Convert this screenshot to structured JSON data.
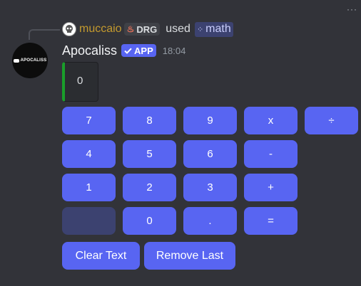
{
  "reply": {
    "username": "muccaio",
    "tag": "DRG",
    "tag_icon": "flame-icon",
    "used": "used",
    "command": "math",
    "command_icon": "app-command-icon"
  },
  "message": {
    "author": "Apocaliss",
    "avatar_text": "APOCALISS",
    "app_badge": "APP",
    "timestamp": "18:04"
  },
  "display": {
    "value": "0",
    "accent_color": "#1a9e2a"
  },
  "buttons": {
    "b7": "7",
    "b8": "8",
    "b9": "9",
    "mul": "x",
    "div": "÷",
    "b4": "4",
    "b5": "5",
    "b6": "6",
    "sub": "-",
    "b1": "1",
    "b2": "2",
    "b3": "3",
    "add": "+",
    "blank": "",
    "b0": "0",
    "dot": ".",
    "eq": "=",
    "clear": "Clear Text",
    "remove": "Remove Last"
  },
  "colors": {
    "button": "#5865f2",
    "button_disabled": "#3c4270",
    "background": "#323339",
    "reply_username": "#c49a2e"
  }
}
